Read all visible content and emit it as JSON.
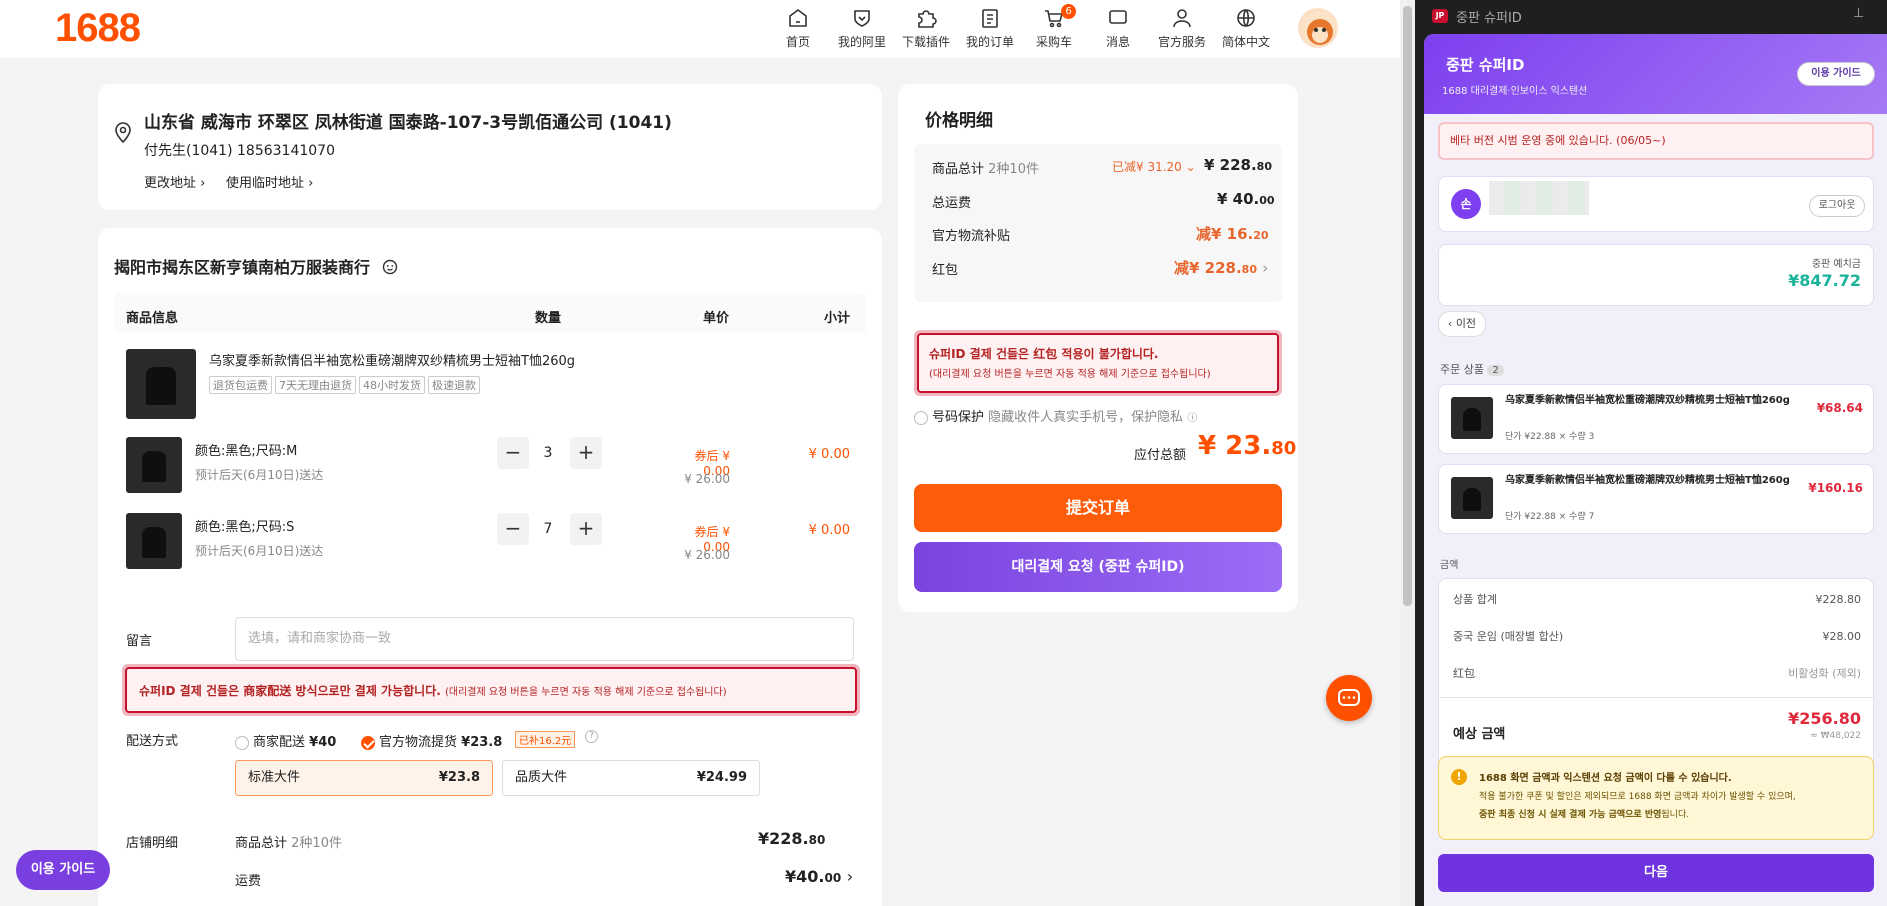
{
  "header": {
    "logo": "1688",
    "nav": [
      {
        "label": "首页",
        "icon": "home-icon"
      },
      {
        "label": "我的阿里",
        "icon": "shield-heart-icon"
      },
      {
        "label": "下载插件",
        "icon": "puzzle-icon"
      },
      {
        "label": "我的订单",
        "icon": "clipboard-icon"
      },
      {
        "label": "采购车",
        "icon": "cart-icon",
        "badge": "6"
      },
      {
        "label": "消息",
        "icon": "chat-icon"
      },
      {
        "label": "官方服务",
        "icon": "user-icon"
      },
      {
        "label": "简体中文",
        "icon": "globe-icon"
      }
    ]
  },
  "address": {
    "line": "山东省 威海市 环翠区 凤林街道 国泰路-107-3号凯佰通公司 (1041)",
    "contact": "付先生(1041) 18563141070",
    "change": "更改地址",
    "temp": "使用临时地址"
  },
  "shop": {
    "name": "揭阳市揭东区新亨镇南柏万服装商行",
    "cols": {
      "info": "商品信息",
      "qty": "数量",
      "unit": "单价",
      "sub": "小计"
    },
    "product": {
      "title": "乌家夏季新款情侣半袖宽松重磅潮牌双纱精梳男士短袖T恤260g",
      "tags": [
        "退货包运费",
        "7天无理由退货",
        "48小时发货",
        "极速退款"
      ]
    },
    "skus": [
      {
        "spec": "颜色:黑色;尺码:M",
        "eta": "预计后天(6月10日)送达",
        "qty": "3",
        "coupon": "券后 ¥ 0.00",
        "price": "¥ 26.00",
        "subtotal": "¥ 0.00"
      },
      {
        "spec": "颜色:黑色;尺码:S",
        "eta": "预计后天(6月10日)送达",
        "qty": "7",
        "coupon": "券后 ¥ 0.00",
        "price": "¥ 26.00",
        "subtotal": "¥ 0.00"
      }
    ],
    "minus": "−",
    "plus": "+",
    "memo_label": "留言",
    "memo_placeholder": "选填，请和商家协商一致",
    "alert_bold": "슈퍼ID 결제 건들은 商家配送 방식으로만 결제 가능합니다.",
    "alert_small": "(대리결제 요청 버튼을 누르면 자동 적용 해제 기준으로 접수됩니다)",
    "ship_label": "配送方式",
    "ship_opt1": "商家配送",
    "ship_opt1_price": "¥40",
    "ship_opt2": "官方物流提货",
    "ship_opt2_price": "¥23.8",
    "ship_subsidy": "已补16.2元",
    "std_label": "标准大件",
    "std_price": "¥23.8",
    "q_label": "品质大件",
    "q_price": "¥24.99",
    "detail_label": "店铺明细",
    "goods_total": "商品总计",
    "goods_count": "2种10件",
    "goods_amount_int": "¥228.",
    "goods_amount_dec": "80",
    "freight": "运费",
    "freight_int": "¥40.",
    "freight_dec": "00"
  },
  "price": {
    "title": "价格明细",
    "goods_total": "商品总计",
    "goods_count": "2种10件",
    "reduced": "已减¥ 31.20",
    "goods_int": "¥ 228.",
    "goods_dec": "80",
    "freight": "总运费",
    "freight_int": "¥ 40.",
    "freight_dec": "00",
    "subsidy": "官方物流补贴",
    "subsidy_int": "减¥ 16.",
    "subsidy_dec": "20",
    "redpack": "红包",
    "redpack_int": "减¥ 228.",
    "redpack_dec": "80",
    "alert_bold": "슈퍼ID 결제 건들은 红包 적용이 불가합니다.",
    "alert_small": "(대리결제 요청 버튼을 누르면 자동 적용 해제 기준으로 접수됩니다)",
    "protect": "号码保护",
    "protect_desc": "隐藏收件人真实手机号，保护隐私",
    "total_label": "应付总额",
    "total_int": "¥ 23.",
    "total_dec": "80",
    "submit": "提交订单",
    "proxy": "대리결제 요청 (중판 슈퍼ID)"
  },
  "float": {
    "guide": "이용 가이드"
  },
  "ext": {
    "titlebar": "중판 슈퍼ID",
    "app_title": "중판 슈퍼ID",
    "subtitle": "1688 대리결제·인보이스 익스텐션",
    "guide": "이용 가이드",
    "beta": "베타 버전 시범 운영 중에 있습니다. (06/05~)",
    "avatar": "손",
    "logout": "로그아웃",
    "deposit_label": "중판 예치금",
    "deposit": "¥847.72",
    "back": "‹ 이전",
    "items_label": "주문 상품",
    "items_count": "2",
    "items": [
      {
        "name": "乌家夏季新款情侣半袖宽松重磅潮牌双纱精梳男士短袖T恤260g",
        "meta": "단가 ¥22.88 × 수량 3",
        "price": "¥68.64"
      },
      {
        "name": "乌家夏季新款情侣半袖宽松重磅潮牌双纱精梳男士短袖T恤260g",
        "meta": "단가 ¥22.88 × 수량 7",
        "price": "¥160.16"
      }
    ],
    "amount_label": "금액",
    "rows": [
      {
        "k": "상품 합계",
        "v": "¥228.80"
      },
      {
        "k": "중국 운임 (매장별 합산)",
        "v": "¥28.00"
      },
      {
        "k": "红包",
        "v": "비활성화 (제외)"
      }
    ],
    "est_label": "예상 금액",
    "est": "¥256.80",
    "est_krw": "≈ ₩48,022",
    "warn_title": "1688 화면 금액과 익스텐션 요청 금액이 다를 수 있습니다.",
    "warn_body": "적용 불가한 쿠폰 및 할인은 제외되므로 1688 화면 금액과 차이가 발생할 수 있으며,",
    "warn_bold": "중판 최종 신청 시 실제 결제 가능 금액으로 반영",
    "warn_end": "됩니다.",
    "next": "다음"
  }
}
